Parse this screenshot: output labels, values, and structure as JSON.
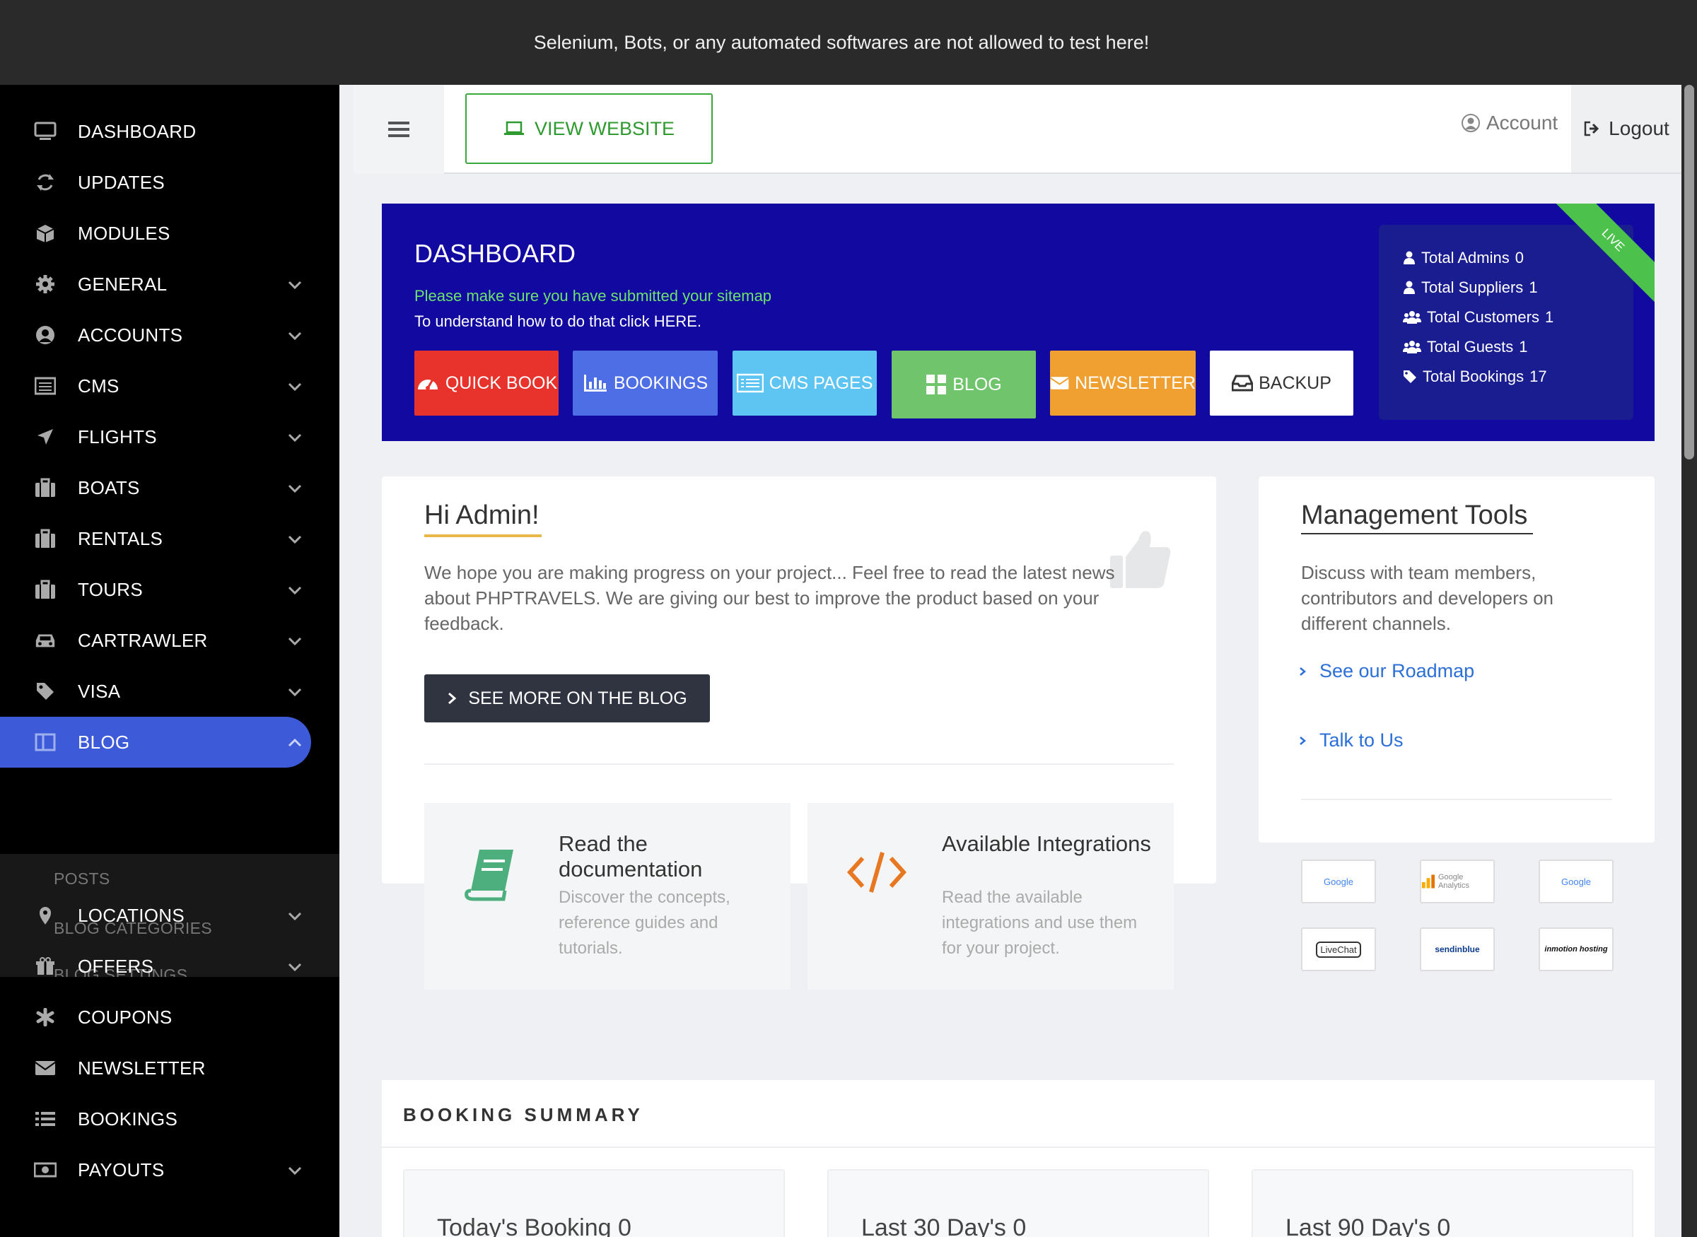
{
  "banner": {
    "text": "Selenium, Bots, or any automated softwares are not allowed to test here!"
  },
  "sidebar": {
    "items": [
      {
        "label": "DASHBOARD",
        "icon": "monitor-icon"
      },
      {
        "label": "UPDATES",
        "icon": "refresh-icon"
      },
      {
        "label": "MODULES",
        "icon": "cube-icon"
      },
      {
        "label": "GENERAL",
        "icon": "gear-icon"
      },
      {
        "label": "ACCOUNTS",
        "icon": "user-circle-icon"
      },
      {
        "label": "CMS",
        "icon": "list-box-icon"
      },
      {
        "label": "FLIGHTS",
        "icon": "plane-icon"
      },
      {
        "label": "BOATS",
        "icon": "suitcase-icon"
      },
      {
        "label": "RENTALS",
        "icon": "suitcase-icon"
      },
      {
        "label": "TOURS",
        "icon": "suitcase-icon"
      },
      {
        "label": "CARTRAWLER",
        "icon": "car-icon"
      },
      {
        "label": "VISA",
        "icon": "tag-icon"
      },
      {
        "label": "BLOG",
        "icon": "columns-icon"
      },
      {
        "label": "LOCATIONS",
        "icon": "map-pin-icon"
      },
      {
        "label": "OFFERS",
        "icon": "gift-icon"
      },
      {
        "label": "COUPONS",
        "icon": "asterisk-icon"
      },
      {
        "label": "NEWSLETTER",
        "icon": "envelope-icon"
      },
      {
        "label": "BOOKINGS",
        "icon": "list-icon"
      },
      {
        "label": "PAYOUTS",
        "icon": "money-icon"
      }
    ],
    "blog_sub": [
      "POSTS",
      "BLOG CATEGORIES",
      "BLOG SETTINGS"
    ]
  },
  "topbar": {
    "view_website": "VIEW WEBSITE",
    "account": "Account",
    "logout": "Logout"
  },
  "hero": {
    "title": "DASHBOARD",
    "line1": "Please make sure you have submitted your sitemap",
    "line2": "To understand how to do that click HERE.",
    "ribbon": "LIVE",
    "buttons": [
      {
        "label": "QUICK BOOK",
        "color": "#e8322c"
      },
      {
        "label": "BOOKINGS",
        "color": "#4e6ee6"
      },
      {
        "label": "CMS PAGES",
        "color": "#5ec4f2"
      },
      {
        "label": "BLOG",
        "color": "#70c46c"
      },
      {
        "label": "NEWSLETTER",
        "color": "#f0a030"
      },
      {
        "label": "BACKUP",
        "color": "#ffffff"
      }
    ],
    "stats": [
      {
        "label": "Total Admins",
        "value": "0"
      },
      {
        "label": "Total Suppliers",
        "value": "1"
      },
      {
        "label": "Total Customers",
        "value": "1"
      },
      {
        "label": "Total Guests",
        "value": "1"
      },
      {
        "label": "Total Bookings",
        "value": "17"
      }
    ]
  },
  "hi": {
    "title": "Hi Admin!",
    "text": "We hope you are making progress on your project... Feel free to read the latest news about PHPTRAVELS. We are giving our best to improve the product based on your feedback.",
    "button": "SEE MORE ON THE BLOG",
    "docs": {
      "title": "Read the documentation",
      "desc": "Discover the concepts, reference guides and tutorials."
    },
    "integrations": {
      "title": "Available Integrations",
      "desc": "Read the available integrations and use them for your project."
    }
  },
  "mgmt": {
    "title": "Management Tools",
    "text": "Discuss with team members, contributors and developers on different channels.",
    "links": [
      "See our Roadmap",
      "Talk to Us"
    ],
    "logos": [
      "Google",
      "Google Analytics",
      "Google",
      "LiveChat",
      "sendinblue",
      "inmotion hosting"
    ]
  },
  "summary": {
    "title": "BOOKING SUMMARY",
    "boxes": [
      "Today's Booking 0",
      "Last 30 Day's 0",
      "Last 90 Day's 0"
    ]
  }
}
